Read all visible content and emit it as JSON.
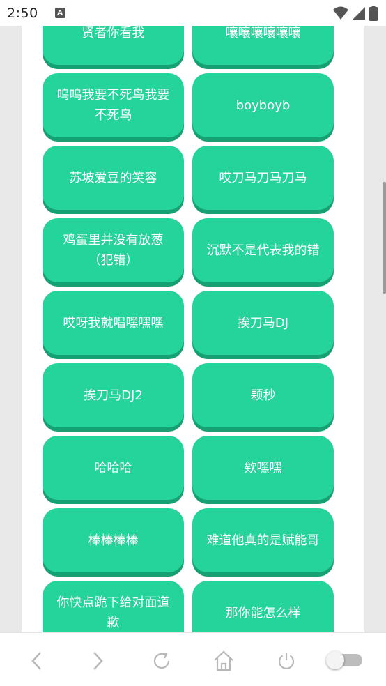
{
  "status_bar": {
    "time": "2:50",
    "notification_icon_letter": "A"
  },
  "buttons": [
    {
      "label": "贤者你看我"
    },
    {
      "label": "嚷嚷嚷嚷嚷嚷"
    },
    {
      "label": "呜呜我要不死鸟我要不死鸟"
    },
    {
      "label": "boyboyb"
    },
    {
      "label": "苏坡爱豆的笑容"
    },
    {
      "label": "哎刀马刀马刀马"
    },
    {
      "label": "鸡蛋里并没有放葱（犯错）"
    },
    {
      "label": "沉默不是代表我的错"
    },
    {
      "label": "哎呀我就唱嘿嘿嘿"
    },
    {
      "label": "挨刀马DJ"
    },
    {
      "label": "挨刀马DJ2"
    },
    {
      "label": "颗秒"
    },
    {
      "label": "哈哈哈"
    },
    {
      "label": "欸嘿嘿"
    },
    {
      "label": "棒棒棒棒"
    },
    {
      "label": "难道他真的是赋能哥"
    },
    {
      "label": "你快点跪下给对面道歉"
    },
    {
      "label": "那你能怎么样"
    }
  ],
  "colors": {
    "button_bg": "#24d49a",
    "button_shadow": "#17a073",
    "page_bg": "#e9e9ea"
  },
  "bottom_nav": {
    "icons": [
      "back-icon",
      "forward-icon",
      "refresh-icon",
      "home-icon",
      "power-icon",
      "toggle-switch"
    ],
    "toggle_on": false
  }
}
